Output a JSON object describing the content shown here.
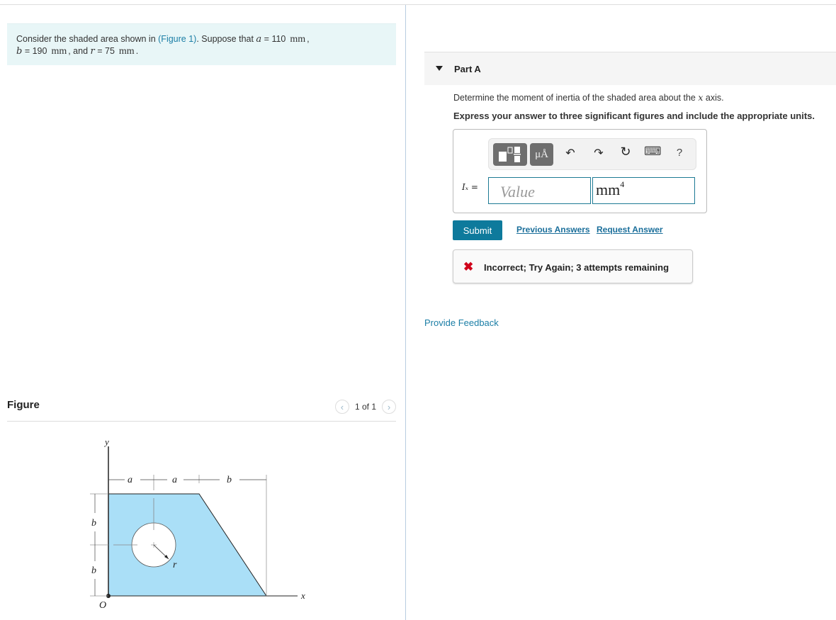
{
  "problem": {
    "intro": "Consider the shaded area shown in ",
    "figure_link": "(Figure 1)",
    "after_link": ". Suppose that ",
    "a_var": "a",
    "a_value": "= 110",
    "b_var": "b",
    "b_value": "= 190",
    "r_var": "r",
    "r_value": "= 75",
    "unit": "mm",
    "sep1": ",",
    "sep2": ", and ",
    "end": "."
  },
  "figure": {
    "title": "Figure",
    "pager": "1 of 1",
    "prev_icon": "‹",
    "next_icon": "›",
    "labels": {
      "y": "y",
      "x": "x",
      "origin": "O",
      "a1": "a",
      "a2": "a",
      "b_top": "b",
      "b_left1": "b",
      "b_left2": "b",
      "r": "r"
    },
    "colors": {
      "fill": "#aadff7",
      "stroke": "#222222"
    }
  },
  "partA": {
    "title": "Part A",
    "question_pre": "Determine the moment of inertia of the shaded area about the ",
    "question_var": "x",
    "question_post": " axis.",
    "instruction": "Express your answer to three significant figures and include the appropriate units.",
    "toolbar": {
      "template_icon": "template-icon",
      "units_label": "μÅ",
      "undo_icon": "↶",
      "redo_icon": "↷",
      "reset_icon": "↻",
      "keyboard_icon": "⌨",
      "help_label": "?"
    },
    "answer_label": "Iₓ =",
    "value_placeholder": "Value",
    "unit_value": "mm",
    "unit_exponent": "4",
    "submit_label": "Submit",
    "previous_answers": "Previous Answers",
    "request_answer": "Request Answer",
    "feedback_icon": "✖",
    "feedback": "Incorrect; Try Again; 3 attempts remaining"
  },
  "provide_feedback": "Provide Feedback",
  "colors": {
    "accent": "#0e7a9c",
    "link": "#1b7ea6",
    "error": "#d0021b",
    "problem_bg": "#e8f6f7"
  }
}
